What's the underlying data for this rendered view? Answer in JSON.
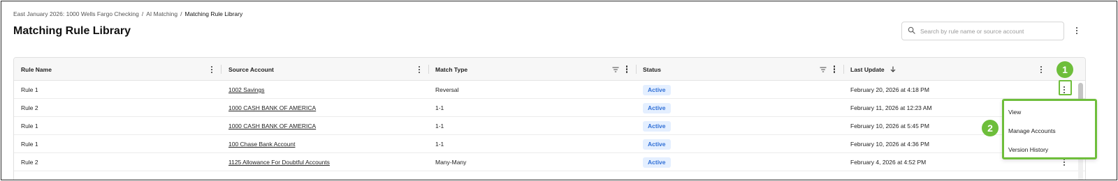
{
  "breadcrumb": {
    "items": [
      "East January 2026: 1000 Wells Fargo Checking",
      "AI Matching"
    ],
    "separator": "/",
    "current": "Matching Rule Library"
  },
  "page": {
    "title": "Matching Rule Library"
  },
  "search": {
    "placeholder": "Search by rule name or source account",
    "value": "",
    "icon": "search-icon"
  },
  "table": {
    "columns": [
      "Rule Name",
      "Source Account",
      "Match Type",
      "Status",
      "Last Update"
    ],
    "sorted_column": "Last Update",
    "sort_direction": "descending",
    "filtered_columns": [
      "Match Type",
      "Status"
    ],
    "rows": [
      {
        "rule_name": "Rule 1",
        "source_account": "1002 Savings",
        "match_type": "Reversal",
        "status": "Active",
        "last_update": "February 20, 2026 at 4:18 PM"
      },
      {
        "rule_name": "Rule 2",
        "source_account": "1000 CASH BANK OF AMERICA",
        "match_type": "1-1",
        "status": "Active",
        "last_update": "February 11, 2026 at 12:23 AM"
      },
      {
        "rule_name": "Rule 1",
        "source_account": "1000 CASH BANK OF AMERICA",
        "match_type": "1-1",
        "status": "Active",
        "last_update": "February 10, 2026 at 5:45 PM"
      },
      {
        "rule_name": "Rule 1",
        "source_account": "100 Chase Bank Account",
        "match_type": "1-1",
        "status": "Active",
        "last_update": "February 10, 2026 at 4:36 PM"
      },
      {
        "rule_name": "Rule 2",
        "source_account": "1125 Allowance For Doubtful Accounts",
        "match_type": "Many-Many",
        "status": "Active",
        "last_update": "February 4, 2026 at 4:52 PM"
      }
    ]
  },
  "row_menu": {
    "items": [
      "View",
      "Manage Accounts",
      "Version History"
    ]
  },
  "callouts": [
    "1",
    "2"
  ],
  "colors": {
    "callout_green": "#6ebe3b",
    "badge_bg": "#e4efff",
    "badge_text": "#2f6fd6"
  }
}
